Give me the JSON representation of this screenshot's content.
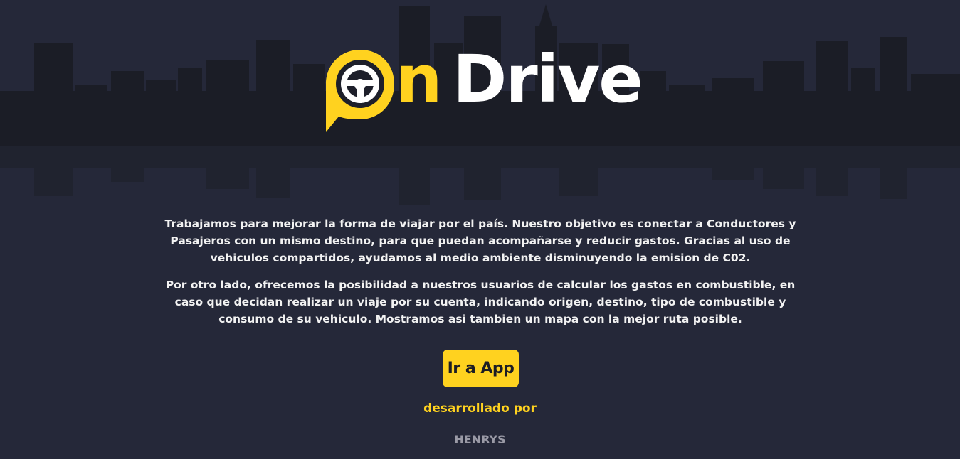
{
  "brand": {
    "logo_letter": "n",
    "logo_word": "Drive",
    "accent_color": "#FFD21F"
  },
  "about": {
    "paragraph_1": "Trabajamos para mejorar la forma de viajar por el país. Nuestro objetivo es conectar a Conductores y Pasajeros con un mismo destino, para que puedan acompañarse y reducir gastos. Gracias al uso de vehiculos compartidos, ayudamos al medio ambiente disminuyendo la emision de C02.",
    "paragraph_2": "Por otro lado, ofrecemos la posibilidad a nuestros usuarios de calcular los gastos en combustible, en caso que decidan realizar un viaje por su cuenta, indicando origen, destino, tipo de combustible y consumo de su vehiculo. Mostramos asi tambien un mapa con la mejor ruta posible."
  },
  "cta": {
    "label": "Ir a App"
  },
  "footer": {
    "developed_by": "desarrollado por",
    "author": "HENRYS"
  },
  "icons": {
    "logo_pin": "map-pin-steering-wheel-icon"
  }
}
